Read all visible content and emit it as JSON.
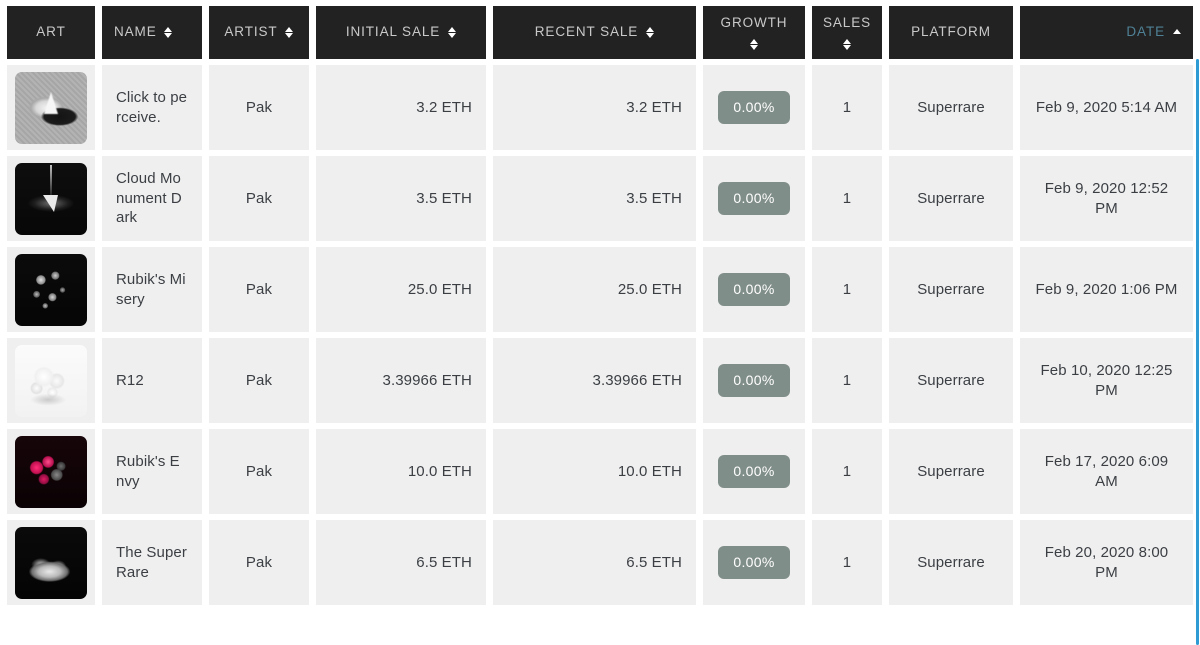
{
  "table": {
    "columns": [
      {
        "key": "art",
        "label": "ART",
        "sortable": false,
        "align": "center",
        "sorted": false,
        "sort_dir": null
      },
      {
        "key": "name",
        "label": "NAME",
        "sortable": true,
        "align": "left",
        "sorted": false,
        "sort_dir": null
      },
      {
        "key": "artist",
        "label": "ARTIST",
        "sortable": true,
        "align": "center",
        "sorted": false,
        "sort_dir": null
      },
      {
        "key": "initial_sale",
        "label": "INITIAL SALE",
        "sortable": true,
        "align": "right",
        "sorted": false,
        "sort_dir": null
      },
      {
        "key": "recent_sale",
        "label": "RECENT SALE",
        "sortable": true,
        "align": "right",
        "sorted": false,
        "sort_dir": null
      },
      {
        "key": "growth",
        "label": "GROWTH",
        "sortable": true,
        "align": "center",
        "sorted": false,
        "sort_dir": null
      },
      {
        "key": "sales",
        "label": "SALES",
        "sortable": true,
        "align": "center",
        "sorted": false,
        "sort_dir": null
      },
      {
        "key": "platform",
        "label": "PLATFORM",
        "sortable": false,
        "align": "center",
        "sorted": false,
        "sort_dir": null
      },
      {
        "key": "date",
        "label": "DATE",
        "sortable": true,
        "align": "right",
        "sorted": true,
        "sort_dir": "asc"
      }
    ],
    "rows": [
      {
        "art_alt": "Click to perceive. artwork thumbnail",
        "name": "Click to perceive.",
        "artist": "Pak",
        "initial_sale": "3.2 ETH",
        "recent_sale": "3.2 ETH",
        "growth": "0.00%",
        "sales": "1",
        "platform": "Superrare",
        "date": "Feb 9, 2020 5:14 AM"
      },
      {
        "art_alt": "Cloud Monument Dark artwork thumbnail",
        "name": "Cloud Monument Dark",
        "artist": "Pak",
        "initial_sale": "3.5 ETH",
        "recent_sale": "3.5 ETH",
        "growth": "0.00%",
        "sales": "1",
        "platform": "Superrare",
        "date": "Feb 9, 2020 12:52 PM"
      },
      {
        "art_alt": "Rubik's Misery artwork thumbnail",
        "name": "Rubik's Misery",
        "artist": "Pak",
        "initial_sale": "25.0 ETH",
        "recent_sale": "25.0 ETH",
        "growth": "0.00%",
        "sales": "1",
        "platform": "Superrare",
        "date": "Feb 9, 2020 1:06 PM"
      },
      {
        "art_alt": "R12 artwork thumbnail",
        "name": "R12",
        "artist": "Pak",
        "initial_sale": "3.39966 ETH",
        "recent_sale": "3.39966 ETH",
        "growth": "0.00%",
        "sales": "1",
        "platform": "Superrare",
        "date": "Feb 10, 2020 12:25 PM"
      },
      {
        "art_alt": "Rubik's Envy artwork thumbnail",
        "name": "Rubik's Envy",
        "artist": "Pak",
        "initial_sale": "10.0 ETH",
        "recent_sale": "10.0 ETH",
        "growth": "0.00%",
        "sales": "1",
        "platform": "Superrare",
        "date": "Feb 17, 2020 6:09 AM"
      },
      {
        "art_alt": "The Super Rare artwork thumbnail",
        "name": "The Super Rare",
        "artist": "Pak",
        "initial_sale": "6.5 ETH",
        "recent_sale": "6.5 ETH",
        "growth": "0.00%",
        "sales": "1",
        "platform": "Superrare",
        "date": "Feb 20, 2020 8:00 PM"
      }
    ]
  },
  "colors": {
    "header_bg": "#222222",
    "header_text": "#c9c9c9",
    "sorted_header_text": "#4f8196",
    "cell_bg": "#efefef",
    "cell_text": "#3b3f44",
    "growth_badge_bg": "#808e8a",
    "growth_badge_text": "#ffffff",
    "scrollbar": "#2f9bd4",
    "page_bg": "#ffffff"
  }
}
